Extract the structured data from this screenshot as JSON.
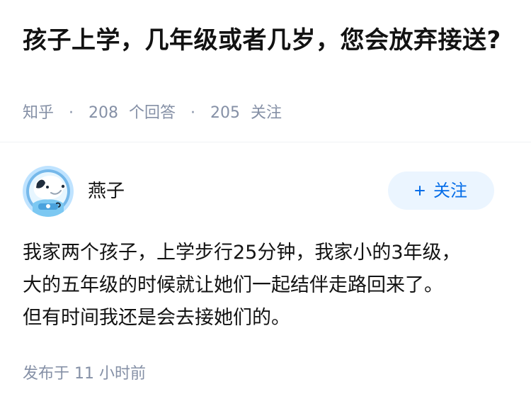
{
  "question": {
    "title": "孩子上学，几年级或者几岁，您会放弃接送?",
    "site": "知乎",
    "separator": "·",
    "answer_count": "208",
    "answer_label": "个回答",
    "follower_count": "205",
    "follower_label": "关注"
  },
  "answer": {
    "author": {
      "name": "燕子",
      "avatar_icon": "astronaut-dog-avatar-icon"
    },
    "follow_button": {
      "icon": "plus-icon",
      "label": "关注"
    },
    "content": {
      "line_1": "我家两个孩子，上学步行25分钟，我家小的3年级，",
      "line_2": "大的五年级的时候就让她们一起结伴走路回来了。",
      "line_3": "但有时间我还是会去接她们的。"
    },
    "published": "发布于  11 小时前"
  },
  "colors": {
    "title": "#121212",
    "meta": "#8590a6",
    "accent": "#056de8",
    "button_bg": "#ebf5ff",
    "divider": "#f0f2f5"
  }
}
